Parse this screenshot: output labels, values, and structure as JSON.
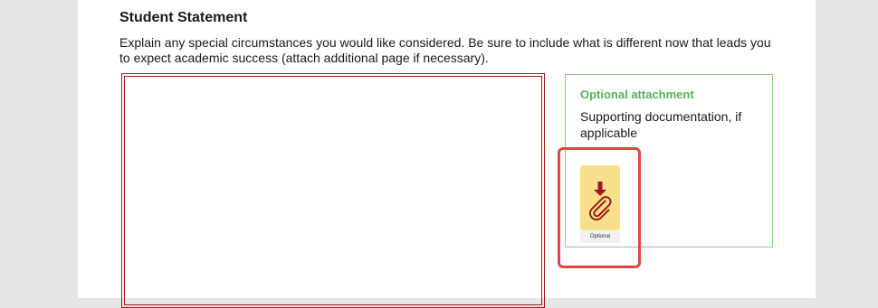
{
  "section": {
    "title": "Student Statement",
    "instructions": "Explain any special circumstances you would like considered. Be sure to include what is different now that leads you to expect academic success (attach additional page if necessary)."
  },
  "statement_box": {
    "value": ""
  },
  "attachment": {
    "title": "Optional attachment",
    "description": "Supporting documentation, if applicable",
    "icon": "download-paperclip-icon",
    "icon_label": "Optional",
    "colors": {
      "title": "#56b35a",
      "border": "#8fcc8a",
      "icon_background": "#f8df8c",
      "icon_symbol": "#9d1a1f"
    }
  },
  "colors": {
    "statement_border": "#9d1a1f",
    "highlight": "#e0453e",
    "canvas": "#e6e6e6"
  }
}
